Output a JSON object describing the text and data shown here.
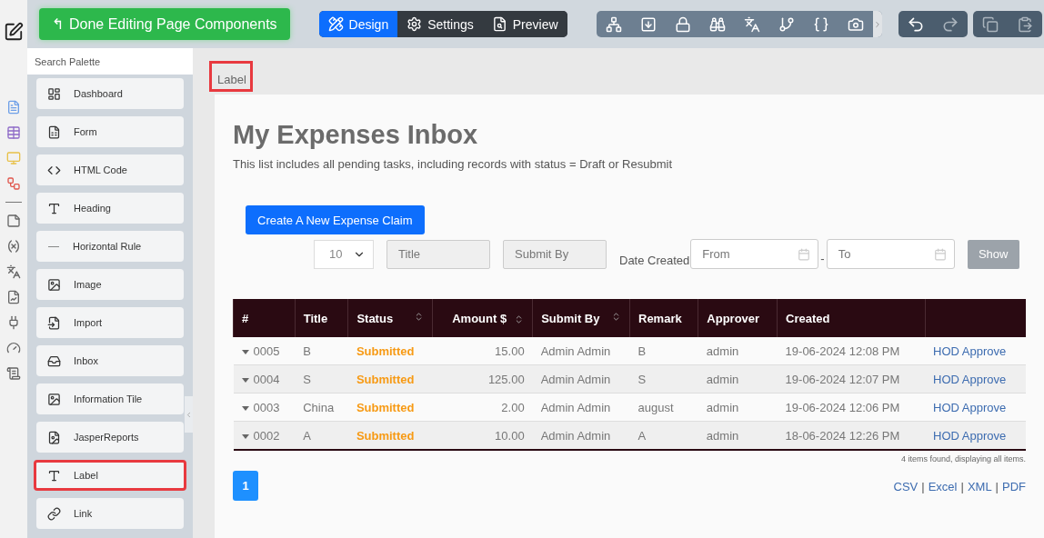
{
  "toolbar": {
    "done_button": "Done Editing Page Components",
    "arrow": "↰",
    "modes": [
      {
        "label": "Design",
        "selected": true
      },
      {
        "label": "Settings",
        "selected": false
      },
      {
        "label": "Preview",
        "selected": false
      }
    ]
  },
  "palette": {
    "search": {
      "placeholder": "Search Palette"
    },
    "items": [
      {
        "label": "Dashboard",
        "highlighted": false
      },
      {
        "label": "Form",
        "highlighted": false
      },
      {
        "label": "HTML Code",
        "highlighted": false
      },
      {
        "label": "Heading",
        "highlighted": false
      },
      {
        "label": "Horizontal Rule",
        "highlighted": false
      },
      {
        "label": "Image",
        "highlighted": false
      },
      {
        "label": "Import",
        "highlighted": false
      },
      {
        "label": "Inbox",
        "highlighted": false
      },
      {
        "label": "Information Tile",
        "highlighted": false
      },
      {
        "label": "JasperReports",
        "highlighted": false
      },
      {
        "label": "Label",
        "highlighted": true
      },
      {
        "label": "Link",
        "highlighted": false
      }
    ]
  },
  "canvas": {
    "label": {
      "text": "Label",
      "highlighted": true
    },
    "title": "My Expenses Inbox",
    "description": "This list includes all pending tasks, including records with status = Draft or Resubmit",
    "create_button": "Create A New Expense Claim",
    "filters": {
      "page_size": "10",
      "title": {
        "placeholder": "Title"
      },
      "submit_by": {
        "placeholder": "Submit By"
      },
      "date_label": "Date Created",
      "from": {
        "placeholder": "From"
      },
      "dash": "-",
      "to": {
        "placeholder": "To"
      },
      "show_button": "Show"
    },
    "table": {
      "columns": [
        {
          "label": "#",
          "sortable": false
        },
        {
          "label": "Title",
          "sortable": false
        },
        {
          "label": "Status",
          "sortable": true
        },
        {
          "label": "Amount $",
          "sortable": true
        },
        {
          "label": "Submit By",
          "sortable": true
        },
        {
          "label": "Remark",
          "sortable": false
        },
        {
          "label": "Approver",
          "sortable": false
        },
        {
          "label": "Created",
          "sortable": false
        },
        {
          "sortable": false
        }
      ],
      "rows": [
        {
          "id": "0005",
          "title": "B",
          "status": "Submitted",
          "amount": "15.00",
          "submit_by": "Admin Admin",
          "remark": "B",
          "approver": "admin",
          "created": "19-06-2024 12:08 PM",
          "action": "HOD Approve"
        },
        {
          "id": "0004",
          "title": "S",
          "status": "Submitted",
          "amount": "125.00",
          "submit_by": "Admin Admin",
          "remark": "S",
          "approver": "admin",
          "created": "19-06-2024 12:07 PM",
          "action": "HOD Approve"
        },
        {
          "id": "0003",
          "title": "China",
          "status": "Submitted",
          "amount": "2.00",
          "submit_by": "Admin Admin",
          "remark": "august",
          "approver": "admin",
          "created": "19-06-2024 12:06 PM",
          "action": "HOD Approve"
        },
        {
          "id": "0002",
          "title": "A",
          "status": "Submitted",
          "amount": "10.00",
          "submit_by": "Admin Admin",
          "remark": "A",
          "approver": "admin",
          "created": "18-06-2024 12:26 PM",
          "action": "HOD Approve"
        }
      ],
      "summary": "4 items found, displaying all items."
    },
    "pagination": [
      {
        "label": "1",
        "selected": true
      }
    ],
    "exports": {
      "separator": "|",
      "links": [
        "CSV",
        "Excel",
        "XML",
        "PDF"
      ]
    }
  }
}
